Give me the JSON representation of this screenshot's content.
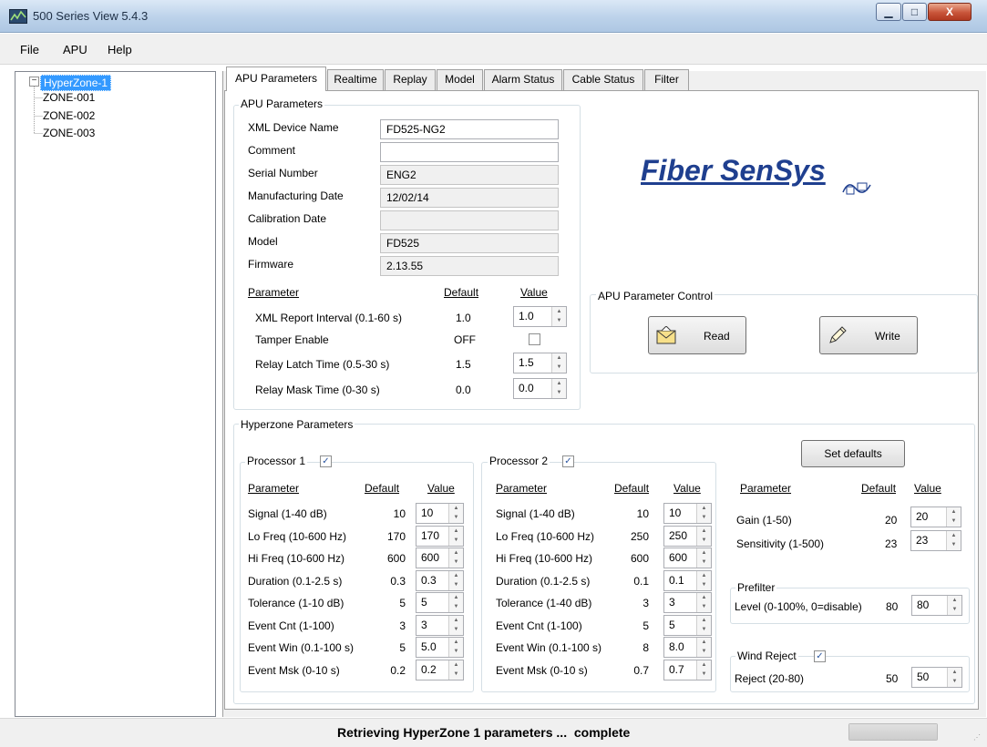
{
  "window": {
    "title": "500 Series View 5.4.3",
    "minimize": "▁",
    "maximize": "□",
    "close": "X"
  },
  "menu": [
    "File",
    "APU",
    "Help"
  ],
  "tree": {
    "root": "HyperZone-1",
    "children": [
      "ZONE-001",
      "ZONE-002",
      "ZONE-003"
    ]
  },
  "tabs": [
    "APU Parameters",
    "Realtime",
    "Replay",
    "Model",
    "Alarm Status",
    "Cable Status",
    "Filter"
  ],
  "apu": {
    "group_title": "APU Parameters",
    "fields": [
      {
        "label": "XML Device Name",
        "value": "FD525-NG2",
        "readonly": false
      },
      {
        "label": "Comment",
        "value": "",
        "readonly": false
      },
      {
        "label": "Serial Number",
        "value": "ENG2",
        "readonly": true
      },
      {
        "label": "Manufacturing Date",
        "value": "12/02/14",
        "readonly": true
      },
      {
        "label": "Calibration Date",
        "value": "",
        "readonly": true
      },
      {
        "label": "Model",
        "value": "FD525",
        "readonly": true
      },
      {
        "label": "Firmware",
        "value": "2.13.55",
        "readonly": true
      }
    ],
    "headers": {
      "parameter": "Parameter",
      "default": "Default",
      "value": "Value"
    },
    "params": [
      {
        "label": "XML Report Interval (0.1-60 s)",
        "default": "1.0",
        "value": "1.0",
        "type": "spin"
      },
      {
        "label": "Tamper Enable",
        "default": "OFF",
        "value": "",
        "type": "check"
      },
      {
        "label": "Relay Latch Time (0.5-30 s)",
        "default": "1.5",
        "value": "1.5",
        "type": "spin"
      },
      {
        "label": "Relay Mask Time (0-30 s)",
        "default": "0.0",
        "value": "0.0",
        "type": "spin"
      }
    ]
  },
  "logo": {
    "text": "Fiber SenSys",
    "color": "#1f3f8f"
  },
  "control": {
    "title": "APU Parameter Control",
    "read": "Read",
    "write": "Write"
  },
  "hyperzone": {
    "title": "Hyperzone Parameters",
    "set_defaults": "Set defaults",
    "headers": {
      "parameter": "Parameter",
      "default": "Default",
      "value": "Value"
    },
    "check_mark": "✓",
    "p1": {
      "title": "Processor 1",
      "rows": [
        {
          "label": "Signal (1-40 dB)",
          "default": "10",
          "value": "10"
        },
        {
          "label": "Lo Freq (10-600 Hz)",
          "default": "170",
          "value": "170"
        },
        {
          "label": "Hi Freq (10-600 Hz)",
          "default": "600",
          "value": "600"
        },
        {
          "label": "Duration (0.1-2.5 s)",
          "default": "0.3",
          "value": "0.3"
        },
        {
          "label": "Tolerance (1-10 dB)",
          "default": "5",
          "value": "5"
        },
        {
          "label": "Event Cnt (1-100)",
          "default": "3",
          "value": "3"
        },
        {
          "label": "Event Win (0.1-100 s)",
          "default": "5",
          "value": "5.0"
        },
        {
          "label": "Event Msk (0-10 s)",
          "default": "0.2",
          "value": "0.2"
        }
      ]
    },
    "p2": {
      "title": "Processor 2",
      "rows": [
        {
          "label": "Signal (1-40 dB)",
          "default": "10",
          "value": "10"
        },
        {
          "label": "Lo Freq (10-600 Hz)",
          "default": "250",
          "value": "250"
        },
        {
          "label": "Hi Freq (10-600 Hz)",
          "default": "600",
          "value": "600"
        },
        {
          "label": "Duration (0.1-2.5 s)",
          "default": "0.1",
          "value": "0.1"
        },
        {
          "label": "Tolerance (1-40 dB)",
          "default": "3",
          "value": "3"
        },
        {
          "label": "Event Cnt (1-100)",
          "default": "5",
          "value": "5"
        },
        {
          "label": "Event Win (0.1-100 s)",
          "default": "8",
          "value": "8.0"
        },
        {
          "label": "Event Msk (0-10 s)",
          "default": "0.7",
          "value": "0.7"
        }
      ]
    },
    "right": [
      {
        "label": "Gain (1-50)",
        "default": "20",
        "value": "20"
      },
      {
        "label": "Sensitivity (1-500)",
        "default": "23",
        "value": "23"
      }
    ],
    "prefilter": {
      "title": "Prefilter",
      "label": "Level (0-100%, 0=disable)",
      "default": "80",
      "value": "80"
    },
    "wind": {
      "title": "Wind Reject",
      "label": "Reject (20-80)",
      "default": "50",
      "value": "50"
    }
  },
  "status": {
    "text": "Retrieving HyperZone 1 parameters ...  complete",
    "progress": 1.0
  }
}
